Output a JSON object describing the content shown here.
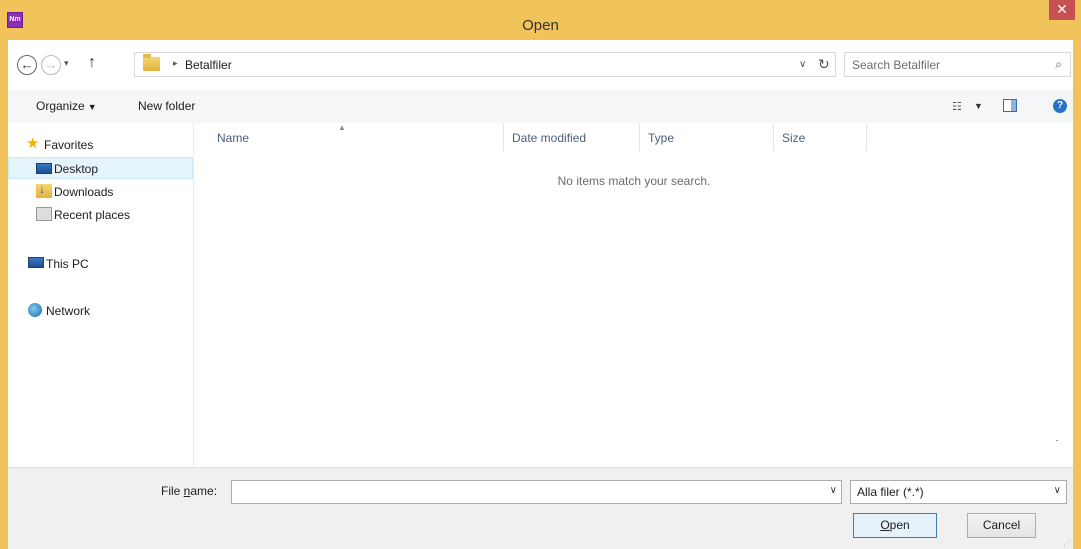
{
  "window": {
    "title": "Open",
    "app_icon_text": "Nm",
    "close_glyph": "✕"
  },
  "address": {
    "back_glyph": "←",
    "forward_glyph": "→",
    "history_glyph": "▾",
    "up_glyph": "↑",
    "separator_glyph": "▸",
    "breadcrumb": "Betalfiler",
    "dropdown_glyph": "∨",
    "refresh_glyph": "↻"
  },
  "search": {
    "placeholder": "Search Betalfiler",
    "icon_glyph": "⌕"
  },
  "toolbar": {
    "organize_label": "Organize",
    "organize_caret": "▼",
    "new_folder_label": "New folder",
    "view_glyph": "☷",
    "view_caret": "▼",
    "help_glyph": "?"
  },
  "nav": {
    "favorites": "Favorites",
    "desktop": "Desktop",
    "downloads": "Downloads",
    "recent": "Recent places",
    "this_pc": "This PC",
    "network": "Network",
    "star_glyph": "★"
  },
  "filelist": {
    "columns": {
      "name": "Name",
      "date_modified": "Date modified",
      "type": "Type",
      "size": "Size"
    },
    "sort_glyph": "▲",
    "empty_message": "No items match your search."
  },
  "bottom": {
    "file_name_label_prefix": "File ",
    "file_name_label_access": "n",
    "file_name_label_suffix": "ame:",
    "file_name_value": "",
    "file_name_dropdown_glyph": "∨",
    "filter_value": "Alla filer (*.*)",
    "filter_dropdown_glyph": "∨",
    "open_access": "O",
    "open_rest": "pen",
    "cancel_label": "Cancel",
    "grip_glyph": "⋰"
  }
}
